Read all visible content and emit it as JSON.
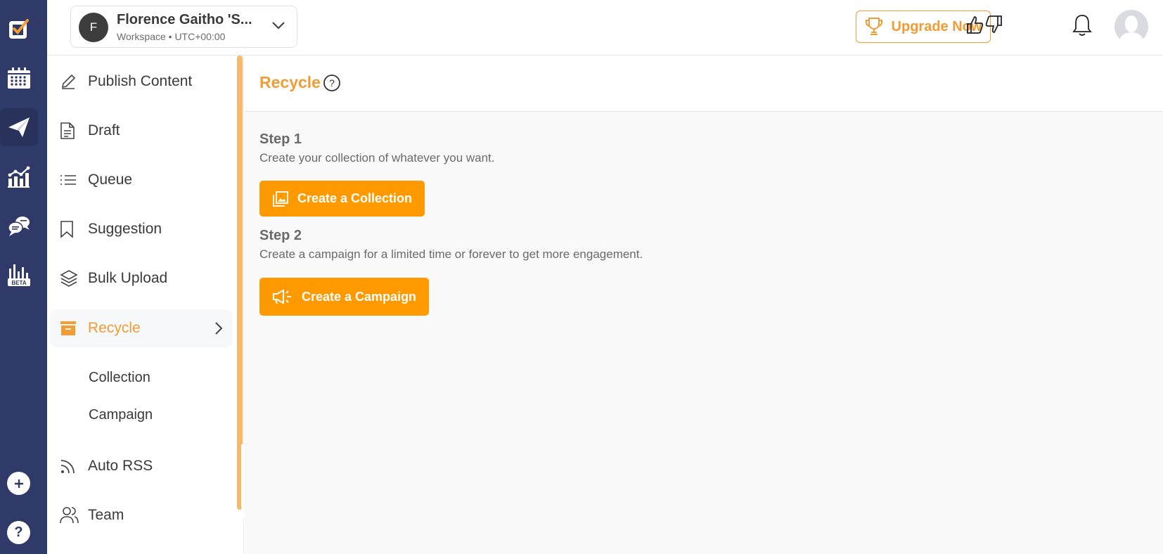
{
  "workspace": {
    "avatar_letter": "F",
    "name": "Florence Gaitho 'S...",
    "subtitle": "Workspace • UTC+00:00"
  },
  "header": {
    "upgrade_label": "Upgrade Now"
  },
  "rail": {
    "items": [
      "logo",
      "calendar",
      "publish",
      "analytics",
      "inbox",
      "analytics-beta"
    ],
    "beta_label": "BETA"
  },
  "sidenav": {
    "items": [
      {
        "label": "Publish Content",
        "icon": "pencil-icon"
      },
      {
        "label": "Draft",
        "icon": "document-icon"
      },
      {
        "label": "Queue",
        "icon": "list-icon"
      },
      {
        "label": "Suggestion",
        "icon": "bookmark-icon"
      },
      {
        "label": "Bulk Upload",
        "icon": "layers-icon"
      },
      {
        "label": "Recycle",
        "icon": "archive-box-icon",
        "active": true
      },
      {
        "label": "Auto RSS",
        "icon": "rss-icon"
      },
      {
        "label": "Team",
        "icon": "users-icon"
      }
    ],
    "sub_items": [
      "Collection",
      "Campaign"
    ]
  },
  "main": {
    "title": "Recycle",
    "step1": {
      "title": "Step 1",
      "description": "Create your collection of whatever you want.",
      "button": "Create a Collection"
    },
    "step2": {
      "title": "Step 2",
      "description": "Create a campaign for a limited time or forever to get more engagement.",
      "button": "Create a Campaign"
    }
  },
  "colors": {
    "accent": "#f39c33",
    "button": "#fe9a00",
    "rail": "#2f3a69"
  }
}
